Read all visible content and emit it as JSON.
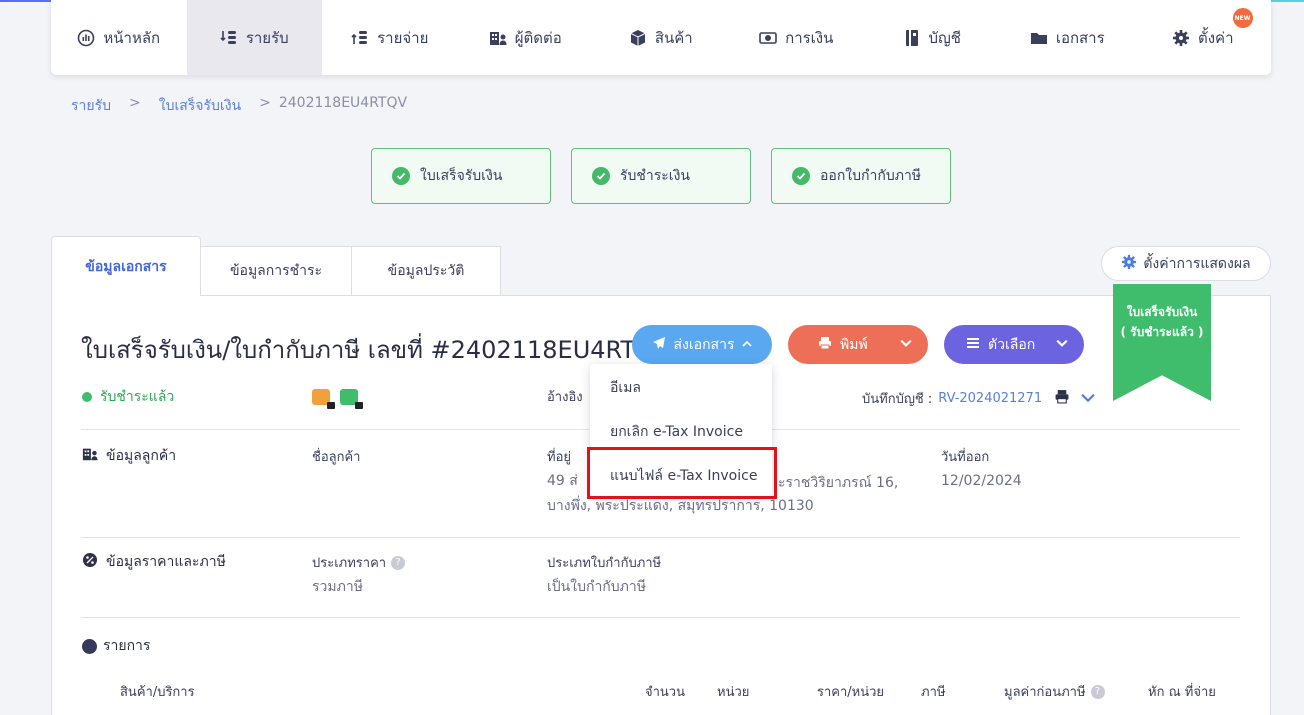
{
  "nav": {
    "items": [
      {
        "label": "หน้าหลัก",
        "icon": "dashboard-icon"
      },
      {
        "label": "รายรับ",
        "icon": "income-icon"
      },
      {
        "label": "รายจ่าย",
        "icon": "expense-icon"
      },
      {
        "label": "ผู้ติดต่อ",
        "icon": "contacts-icon"
      },
      {
        "label": "สินค้า",
        "icon": "box-icon"
      },
      {
        "label": "การเงิน",
        "icon": "money-icon"
      },
      {
        "label": "บัญชี",
        "icon": "ledger-icon"
      },
      {
        "label": "เอกสาร",
        "icon": "folder-icon"
      },
      {
        "label": "ตั้งค่า",
        "icon": "gear-icon"
      }
    ],
    "new_badge": "NEW"
  },
  "breadcrumb": {
    "income": "รายรับ",
    "receipt": "ใบเสร็จรับเงิน",
    "doc_no": "2402118EU4RTQV",
    "sep": ">"
  },
  "steps": [
    "ใบเสร็จรับเงิน",
    "รับชำระเงิน",
    "ออกใบกำกับภาษี"
  ],
  "tabs": {
    "doc_info": "ข้อมูลเอกสาร",
    "payment_info": "ข้อมูลการชำระ",
    "history_info": "ข้อมูลประวัติ"
  },
  "display_settings": "ตั้งค่าการแสดงผล",
  "document": {
    "title": "ใบเสร็จรับเงิน/ใบกำกับภาษี เลขที่ #2402118EU4RTQV",
    "status": "รับชำระแล้ว",
    "ribbon_line1": "ใบเสร็จรับเงิน",
    "ribbon_line2": "( รับชำระแล้ว )",
    "ref_label": "อ้างอิง",
    "ledger_label": "บันทึกบัญชี :",
    "ledger_value": "RV-2024021271"
  },
  "actions": {
    "send": "ส่งเอกสาร",
    "print": "พิมพ์",
    "options": "ตัวเลือก"
  },
  "dropdown": {
    "email": "อีเมล",
    "cancel_etax": "ยกเลิก e-Tax Invoice",
    "attach_etax": "แนบไฟล์ e-Tax Invoice"
  },
  "customer": {
    "section": "ข้อมูลลูกค้า",
    "name_label": "ชื่อลูกค้า",
    "address_label": "ที่อยู่",
    "address_line1": "49 ส่",
    "address_line1_tail": "ะราชวิริยาภรณ์ 16,",
    "address_line2": "บางพึ่ง, พระประแดง, สมุทรปราการ, 10130",
    "issue_label": "วันที่ออก",
    "issue_date": "12/02/2024"
  },
  "pricing": {
    "section": "ข้อมูลราคาและภาษี",
    "price_type_label": "ประเภทราคา",
    "price_type": "รวมภาษี",
    "tax_invoice_label": "ประเภทใบกำกับภาษี",
    "tax_invoice": "เป็นใบกำกับภาษี"
  },
  "items": {
    "section": "รายการ",
    "columns": [
      "สินค้า/บริการ",
      "จำนวน",
      "หน่วย",
      "ราคา/หน่วย",
      "ภาษี",
      "มูลค่าก่อนภาษี",
      "หัก ณ ที่จ่าย"
    ]
  },
  "colors": {
    "accent": "#4566d6",
    "success": "#3fbc6c",
    "send": "#5aa8f0",
    "print": "#ee6f57",
    "options": "#6c63e0",
    "highlight": "#e0121b"
  }
}
